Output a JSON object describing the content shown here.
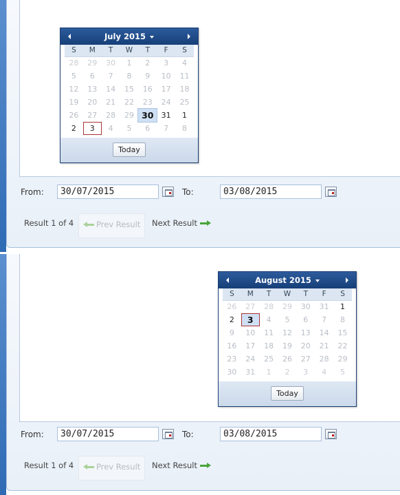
{
  "panels": [
    {
      "date_filter": {
        "from_label": "From:",
        "from_value": "30/07/2015",
        "to_label": "To:",
        "to_value": "03/08/2015"
      },
      "results": {
        "count_text": "Result 1 of 4",
        "prev_label": "Prev Result",
        "next_label": "Next Result"
      },
      "calendar": {
        "title": "July 2015",
        "days_of_week": [
          "S",
          "M",
          "T",
          "W",
          "T",
          "F",
          "S"
        ],
        "weeks": [
          [
            "28",
            "29",
            "30",
            "1",
            "2",
            "3",
            "4"
          ],
          [
            "5",
            "6",
            "7",
            "8",
            "9",
            "10",
            "11"
          ],
          [
            "12",
            "13",
            "14",
            "15",
            "16",
            "17",
            "18"
          ],
          [
            "19",
            "20",
            "21",
            "22",
            "23",
            "24",
            "25"
          ],
          [
            "26",
            "27",
            "28",
            "29",
            "30",
            "31",
            "1"
          ],
          [
            "2",
            "3",
            "4",
            "5",
            "6",
            "7",
            "8"
          ]
        ],
        "today_label": "Today"
      }
    },
    {
      "date_filter": {
        "from_label": "From:",
        "from_value": "30/07/2015",
        "to_label": "To:",
        "to_value": "03/08/2015"
      },
      "results": {
        "count_text": "Result 1 of 4",
        "prev_label": "Prev Result",
        "next_label": "Next Result"
      },
      "calendar": {
        "title": "August 2015",
        "days_of_week": [
          "S",
          "M",
          "T",
          "W",
          "T",
          "F",
          "S"
        ],
        "weeks": [
          [
            "26",
            "27",
            "28",
            "29",
            "30",
            "31",
            "1"
          ],
          [
            "2",
            "3",
            "4",
            "5",
            "6",
            "7",
            "8"
          ],
          [
            "9",
            "10",
            "11",
            "12",
            "13",
            "14",
            "15"
          ],
          [
            "16",
            "17",
            "18",
            "19",
            "20",
            "21",
            "22"
          ],
          [
            "23",
            "24",
            "25",
            "26",
            "27",
            "28",
            "29"
          ],
          [
            "30",
            "31",
            "1",
            "2",
            "3",
            "4",
            "5"
          ]
        ],
        "today_label": "Today"
      }
    }
  ],
  "colors": {
    "accent": "#1b3e73",
    "gutter": "#2f6bb5",
    "selected_day": "#cfe0f4",
    "focus_outline": "#aa3333",
    "next_arrow": "#49a53b"
  }
}
